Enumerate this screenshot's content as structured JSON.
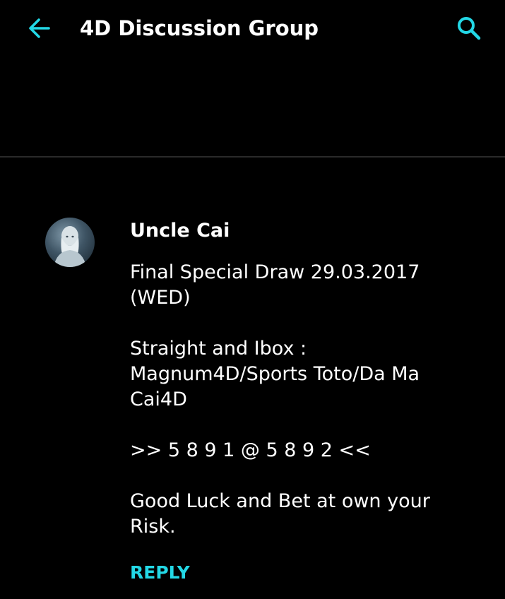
{
  "app_bar": {
    "title": "4D Discussion Group",
    "back_icon": "arrow-left-icon",
    "search_icon": "search-icon",
    "accent_color": "#23d8e6"
  },
  "comment": {
    "author": "Uncle Cai",
    "avatar_icon": "avatar",
    "paragraphs": [
      "Final Special Draw 29.03.2017 (WED)",
      "Straight and Ibox : Magnum4D/Sports Toto/Da Ma Cai4D",
      ">> 5 8 9 1 @ 5 8 9 2 <<",
      "Good Luck and Bet at own your Risk."
    ],
    "reply_label": "REPLY"
  }
}
